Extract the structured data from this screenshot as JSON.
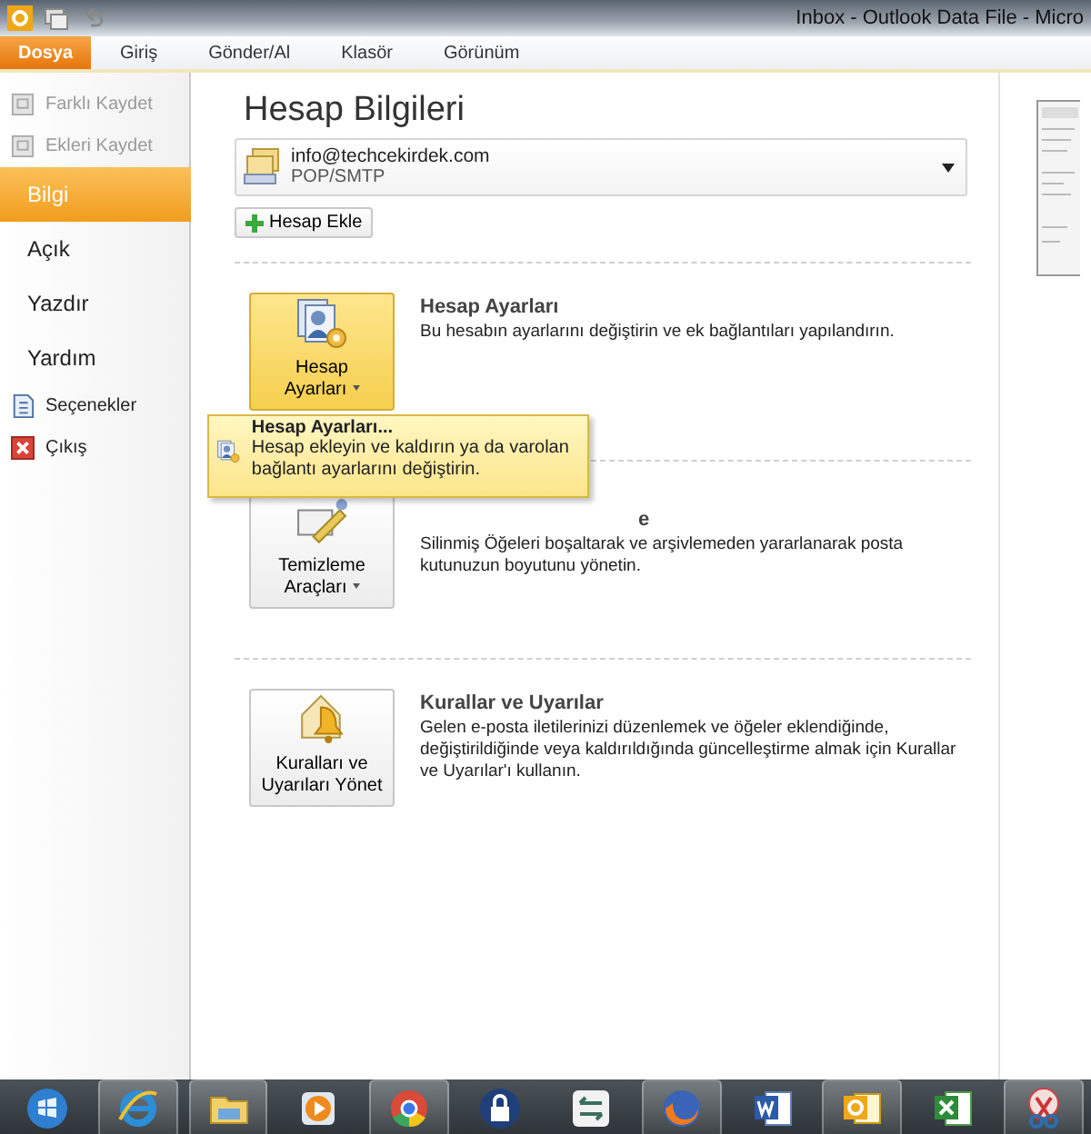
{
  "window": {
    "title": "Inbox - Outlook Data File  -  Micro"
  },
  "ribbon_tabs": [
    {
      "label": "Dosya",
      "selected": true
    },
    {
      "label": "Giriş",
      "selected": false
    },
    {
      "label": "Gönder/Al",
      "selected": false
    },
    {
      "label": "Klasör",
      "selected": false
    },
    {
      "label": "Görünüm",
      "selected": false
    }
  ],
  "sidebar": {
    "items": [
      {
        "label": "Farklı Kaydet",
        "kind": "command",
        "disabled": true
      },
      {
        "label": "Ekleri Kaydet",
        "kind": "command",
        "disabled": true
      },
      {
        "label": "Bilgi",
        "kind": "tab",
        "selected": true
      },
      {
        "label": "Açık",
        "kind": "tab",
        "selected": false
      },
      {
        "label": "Yazdır",
        "kind": "tab",
        "selected": false
      },
      {
        "label": "Yardım",
        "kind": "tab",
        "selected": false
      },
      {
        "label": "Seçenekler",
        "kind": "command",
        "disabled": false
      },
      {
        "label": "Çıkış",
        "kind": "command",
        "disabled": false
      }
    ]
  },
  "heading": "Hesap Bilgileri",
  "account": {
    "email": "info@techcekirdek.com",
    "type": "POP/SMTP"
  },
  "add_account_button": "Hesap Ekle",
  "sections": [
    {
      "button_lines": [
        "Hesap",
        "Ayarları"
      ],
      "dropdown": true,
      "selected": true,
      "title": "Hesap Ayarları",
      "title_covered": false,
      "description": "Bu hesabın ayarlarını değiştirin ve ek bağlantıları yapılandırın.",
      "kind": "accounts"
    },
    {
      "button_lines": [
        "Temizleme",
        "Araçları"
      ],
      "dropdown": true,
      "selected": false,
      "title": "e",
      "title_covered": true,
      "description": "Silinmiş Öğeleri boşaltarak ve arşivlemeden yararlanarak posta kutunuzun boyutunu yönetin.",
      "kind": "cleanup"
    },
    {
      "button_lines": [
        "Kuralları ve",
        "Uyarıları Yönet"
      ],
      "dropdown": false,
      "selected": false,
      "title": "Kurallar ve Uyarılar",
      "title_covered": false,
      "description": "Gelen e-posta iletilerinizi düzenlemek ve öğeler eklendiğinde, değiştirildiğinde veya kaldırıldığında güncelleştirme almak için Kurallar ve Uyarılar'ı kullanın.",
      "kind": "rules"
    }
  ],
  "popup_menu": {
    "title": "Hesap Ayarları...",
    "description": "Hesap ekleyin ve kaldırın ya da varolan bağlantı ayarlarını değiştirin."
  },
  "taskbar": [
    {
      "kind": "start",
      "running": false
    },
    {
      "kind": "ie",
      "running": true
    },
    {
      "kind": "folder",
      "running": true
    },
    {
      "kind": "media",
      "running": false
    },
    {
      "kind": "chrome",
      "running": true
    },
    {
      "kind": "lock",
      "running": false
    },
    {
      "kind": "sync",
      "running": false
    },
    {
      "kind": "firefox",
      "running": true
    },
    {
      "kind": "word",
      "running": false
    },
    {
      "kind": "outlook",
      "running": true
    },
    {
      "kind": "excel",
      "running": false
    },
    {
      "kind": "snip",
      "running": true
    }
  ]
}
